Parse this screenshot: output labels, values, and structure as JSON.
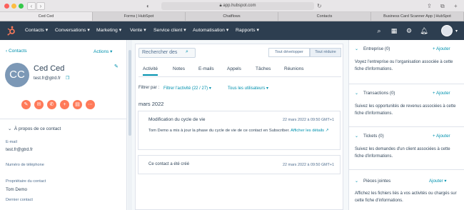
{
  "browser": {
    "url": "app.hubspot.com",
    "tabs": [
      "Ced Ced",
      "Forms | HubSpot",
      "Chatflows",
      "Contacts",
      "Business Card Scanner App | HubSpot"
    ]
  },
  "nav": {
    "items": [
      "Contacts",
      "Conversations",
      "Marketing",
      "Vente",
      "Service client",
      "Automatisation",
      "Rapports"
    ]
  },
  "contact": {
    "back_label": "Contacts",
    "actions_label": "Actions",
    "initials": "CC",
    "name": "Ced Ced",
    "email": "test.fr@gtrd.fr",
    "about_label": "À propos de ce contact",
    "fields": [
      {
        "label": "E-mail",
        "value": "test.fr@gtrd.fr"
      },
      {
        "label": "Numéro de téléphone",
        "value": ""
      },
      {
        "label": "Propriétaire du contact",
        "value": "Tom Demo"
      },
      {
        "label": "Dernier contact",
        "value": ""
      }
    ]
  },
  "activity": {
    "search_placeholder": "Rechercher des",
    "expand_all": "Tout développer",
    "collapse_all": "Tout réduire",
    "tabs": [
      "Activité",
      "Notes",
      "E-mails",
      "Appels",
      "Tâches",
      "Réunions"
    ],
    "filter_label": "Filtrer par :",
    "filter_activity": "Filtrer l'activité (22 / 27)",
    "filter_users": "Tous les utilisateurs",
    "month": "mars 2022",
    "events": [
      {
        "title": "Modification du cycle de vie",
        "date": "22 mars 2022 à 09:50 GMT+1",
        "body_prefix": "Tom Demo a mis à jour la phase du cycle de vie de ce contact en Subscriber.",
        "link": "Afficher les détails"
      },
      {
        "title": "Ce contact a été créé",
        "date": "22 mars 2022 à 09:50 GMT+1"
      }
    ]
  },
  "right": {
    "sections": [
      {
        "title": "Entreprise (0)",
        "add": "+ Ajouter",
        "desc": "Voyez l'entreprise ou l'organisation associée à cette fiche d'informations."
      },
      {
        "title": "Transactions (0)",
        "add": "+ Ajouter",
        "desc": "Suivez les opportunités de revenus associées à cette fiche d'informations."
      },
      {
        "title": "Tickets (0)",
        "add": "+ Ajouter",
        "desc": "Suivez les demandes d'un client associées à cette fiche d'informations."
      },
      {
        "title": "Pièces jointes",
        "add": "Ajouter",
        "desc": "Affichez les fichiers liés à vos activités ou chargés sur cette fiche d'informations."
      }
    ]
  }
}
